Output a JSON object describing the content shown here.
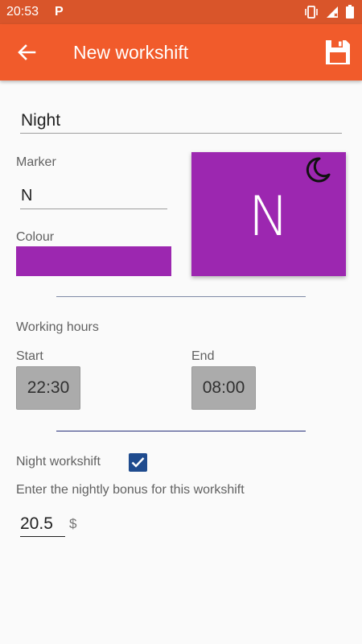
{
  "status_bar": {
    "time": "20:53",
    "notification_letter": "P"
  },
  "app_bar": {
    "title": "New workshift",
    "back_icon": "arrow-back-icon",
    "save_icon": "floppy-disk-icon"
  },
  "form": {
    "name_value": "Night",
    "marker_label": "Marker",
    "marker_value": "N",
    "colour_label": "Colour",
    "colour_value": "#9c27b0",
    "preview": {
      "letter": "N",
      "icon": "moon-icon"
    },
    "working_hours_label": "Working hours",
    "start_label": "Start",
    "start_value": "22:30",
    "end_label": "End",
    "end_value": "08:00",
    "night_workshift_label": "Night workshift",
    "night_workshift_checked": true,
    "bonus_prompt": "Enter the nightly bonus for this workshift",
    "bonus_value": "20.5",
    "currency": "$"
  },
  "colors": {
    "status_bar": "#d9552a",
    "app_bar": "#f15b2b",
    "shift_colour": "#9c27b0",
    "checkbox": "#1f4b8e"
  }
}
